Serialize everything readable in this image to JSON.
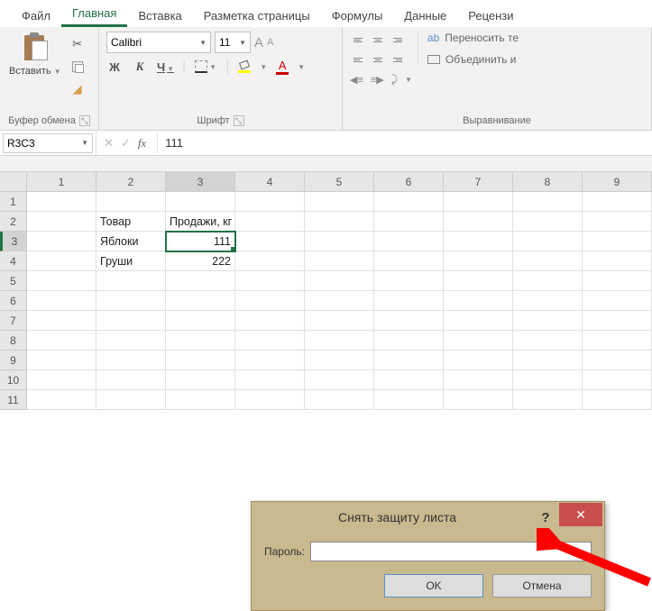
{
  "tabs": {
    "file": "Файл",
    "home": "Главная",
    "insert": "Вставка",
    "layout": "Разметка страницы",
    "formulas": "Формулы",
    "data": "Данные",
    "review": "Рецензи"
  },
  "ribbon": {
    "clipboard": {
      "paste": "Вставить",
      "title": "Буфер обмена"
    },
    "font": {
      "name": "Calibri",
      "size": "11",
      "bold": "Ж",
      "italic": "К",
      "underline": "Ч",
      "title": "Шрифт"
    },
    "alignment": {
      "wrap": "Переносить те",
      "merge": "Объединить и",
      "title": "Выравнивание"
    }
  },
  "namebox": "R3C3",
  "formula": "111",
  "columns": [
    "1",
    "2",
    "3",
    "4",
    "5",
    "6",
    "7",
    "8",
    "9"
  ],
  "rows": [
    "1",
    "2",
    "3",
    "4",
    "5",
    "6",
    "7",
    "8",
    "9",
    "10",
    "11"
  ],
  "cells": {
    "r2c2": "Товар",
    "r2c3": "Продажи, кг",
    "r3c2": "Яблоки",
    "r3c3": "111",
    "r4c2": "Груши",
    "r4c3": "222"
  },
  "dialog": {
    "title": "Снять защиту листа",
    "password_label": "Пароль:",
    "ok": "OK",
    "cancel": "Отмена"
  }
}
